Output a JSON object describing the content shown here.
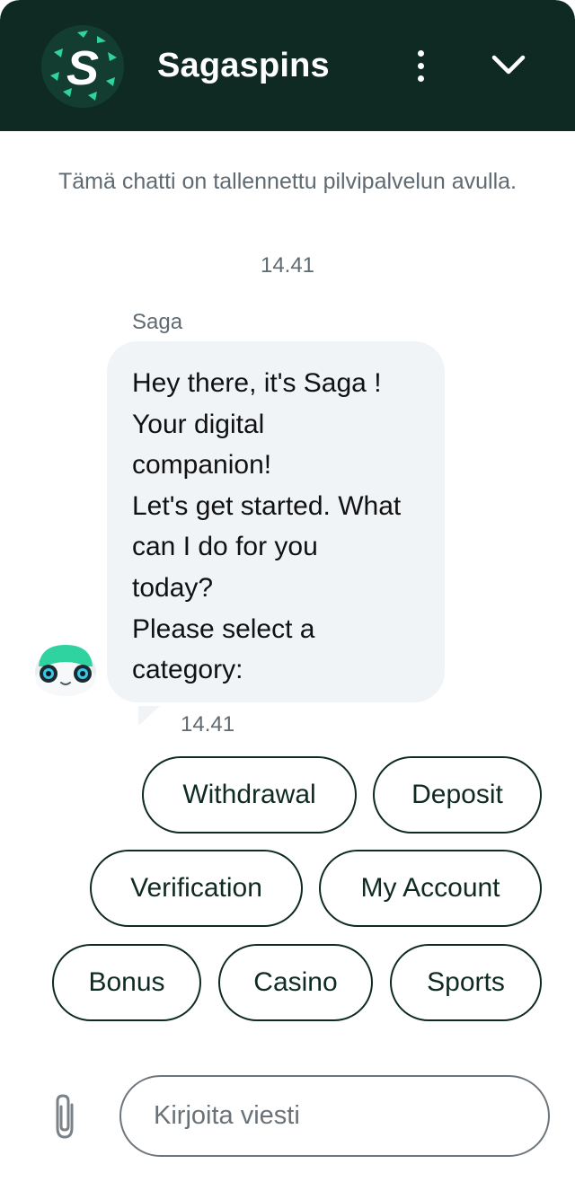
{
  "header": {
    "title": "Sagaspins",
    "logo_icon": "sagaspins-logo-icon",
    "menu_icon": "more-vertical-icon",
    "collapse_icon": "chevron-down-icon",
    "background_color": "#0f2a23"
  },
  "chat": {
    "notice": "Tämä chatti on tallennettu pilvipalvelun avulla.",
    "timestamp": "14.41",
    "messages": [
      {
        "sender": "Saga",
        "avatar_icon": "bot-avatar-icon",
        "lines": [
          "Hey there, it's Saga !",
          "Your digital",
          "companion!",
          "Let's get started. What",
          "can I do for you",
          "today?",
          "Please select a",
          "category:"
        ],
        "time": "14.41"
      }
    ]
  },
  "quick_replies": [
    "Withdrawal",
    "Deposit",
    "Verification",
    "My Account",
    "Bonus",
    "Casino",
    "Sports"
  ],
  "composer": {
    "placeholder": "Kirjoita viesti",
    "value": "",
    "attach_icon": "paperclip-icon"
  },
  "colors": {
    "accent": "#2fd3a0",
    "bubble": "#f1f4f7",
    "muted_text": "#5f6a71"
  }
}
